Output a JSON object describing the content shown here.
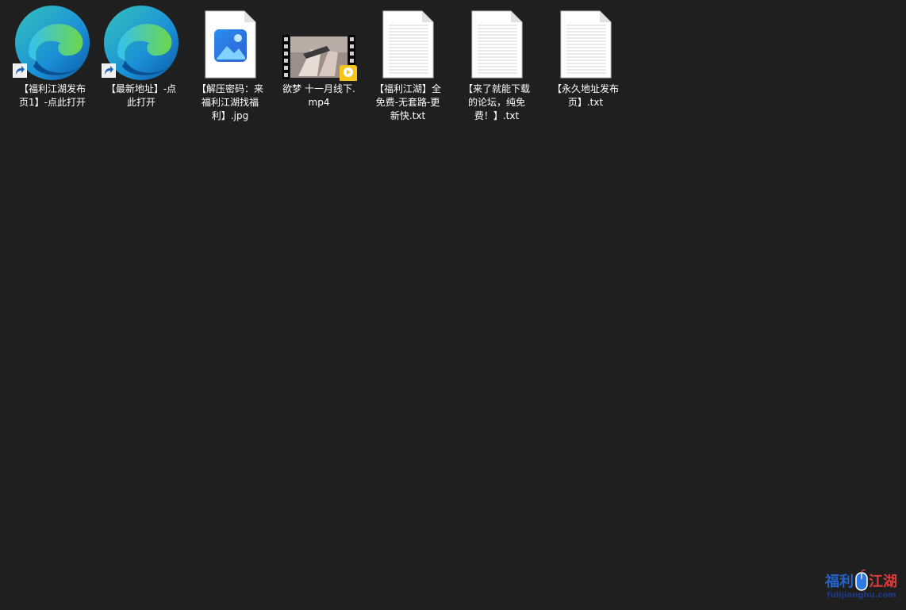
{
  "desktop": {
    "items": [
      {
        "label": "【福利江湖发布页1】-点此打开",
        "icon": "edge-shortcut-icon"
      },
      {
        "label": "【最新地址】-点此打开",
        "icon": "edge-shortcut-icon"
      },
      {
        "label": "【解压密码：来福利江湖找福利】.jpg",
        "icon": "image-file-icon"
      },
      {
        "label": "欲梦 十一月线下.mp4",
        "icon": "video-file-icon"
      },
      {
        "label": "【福利江湖】全免费-无套路-更新快.txt",
        "icon": "text-file-icon"
      },
      {
        "label": "【来了就能下载的论坛，纯免费！】.txt",
        "icon": "text-file-icon"
      },
      {
        "label": "【永久地址发布页】.txt",
        "icon": "text-file-icon"
      }
    ]
  },
  "watermark": {
    "title_a": "福利",
    "title_b": "江湖",
    "subtitle": "fulijianghu.com"
  },
  "colors": {
    "background": "#1f1f1f",
    "label_text": "#ffffff",
    "edge_blue": "#0c59a4",
    "edge_teal": "#33c3bd",
    "edge_green": "#6ed64a",
    "player_badge": "#f5c518"
  }
}
